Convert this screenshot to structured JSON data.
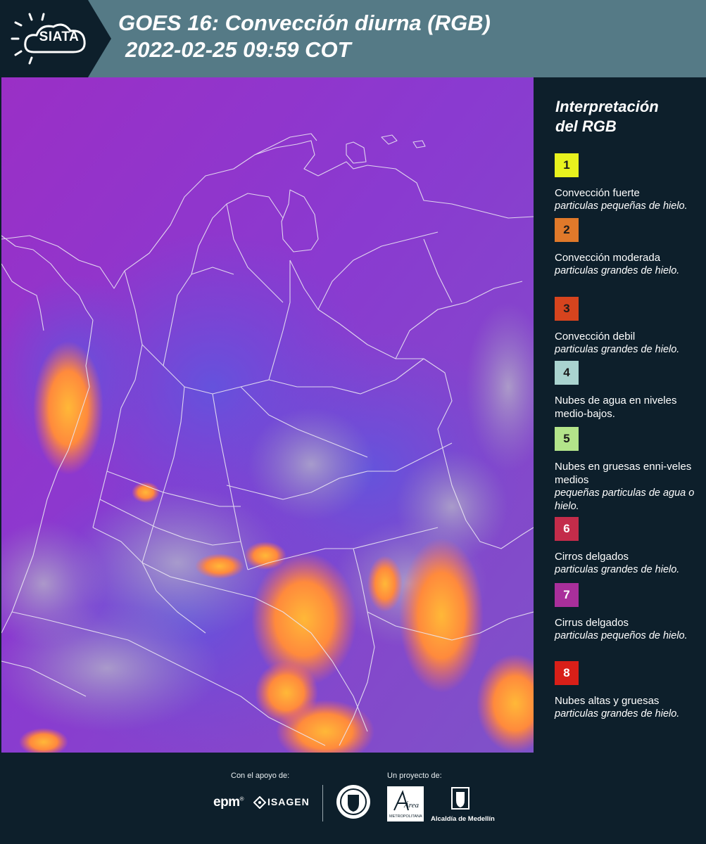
{
  "header": {
    "logo_text": "SIATA",
    "title_line1": "GOES 16: Convección diurna (RGB)",
    "title_line2": "2022-02-25 09:59 COT"
  },
  "colors": {
    "header_bg": "#557a86",
    "panel_bg": "#0d1f2b",
    "map_base_purple": "#8a35c8"
  },
  "legend": {
    "title_line1": "Interpretación",
    "title_line2": "del RGB",
    "items": [
      {
        "number": "1",
        "color": "#e8f21e",
        "name": "Convección fuerte",
        "desc": "particulas pequeñas de hielo."
      },
      {
        "number": "2",
        "color": "#e0792a",
        "name": "Convección moderada",
        "desc": "particulas grandes de hielo."
      },
      {
        "number": "3",
        "color": "#d6441e",
        "name": "Convección debil",
        "desc": "particulas grandes de hielo."
      },
      {
        "number": "4",
        "color": "#a9d3cf",
        "name": "Nubes de agua en niveles medio-bajos.",
        "desc": ""
      },
      {
        "number": "5",
        "color": "#b3e48a",
        "name": "Nubes en gruesas enni-veles medios",
        "desc": "pequeñas particulas de agua o hielo."
      },
      {
        "number": "6",
        "color": "#c32c4a",
        "name": "Cirros delgados",
        "desc": "particulas grandes de hielo."
      },
      {
        "number": "7",
        "color": "#a92f9b",
        "name": "Cirrus delgados",
        "desc": "particulas pequeños de hielo."
      },
      {
        "number": "8",
        "color": "#d81f18",
        "name": "Nubes altas y gruesas",
        "desc": "particulas grandes de hielo."
      }
    ]
  },
  "footer": {
    "support_label": "Con el apoyo de:",
    "project_label": "Un proyecto de:",
    "sponsor1": "epm",
    "sponsor2": "ISAGEN",
    "partner1": "Área",
    "partner1_sub": "METROPOLITANA",
    "partner2": "Alcaldía de Medellín"
  }
}
